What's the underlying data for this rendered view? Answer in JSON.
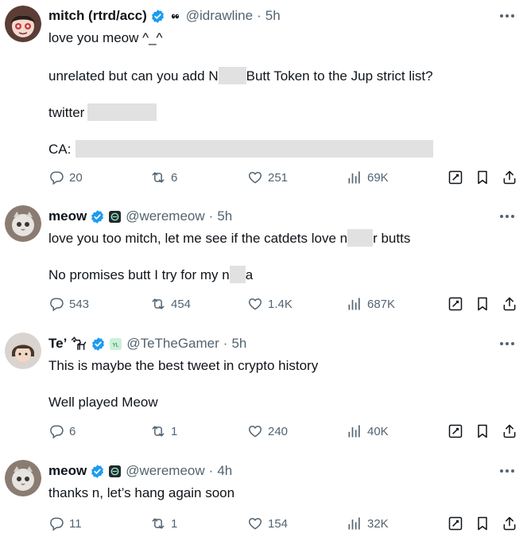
{
  "tweets": [
    {
      "name": "mitch (rtrd/acc)",
      "handle": "@idrawline",
      "time": "5h",
      "text_lines": [
        "love you meow ^_^"
      ],
      "text_parts": {
        "l2_a": "unrelated but can you add N",
        "l2_b": "Butt Token to the Jup strict list?",
        "l3": "twitter",
        "l4": "CA:"
      },
      "stats": {
        "replies": "20",
        "retweets": "6",
        "likes": "251",
        "views": "69K"
      }
    },
    {
      "name": "meow",
      "handle": "@weremeow",
      "time": "5h",
      "text_parts": {
        "l1_a": "love you too mitch, let me see if the catdets love n",
        "l1_b": "r butts",
        "l2_a": "No promises butt I try for my n",
        "l2_b": "a"
      },
      "stats": {
        "replies": "543",
        "retweets": "454",
        "likes": "1.4K",
        "views": "687K"
      }
    },
    {
      "name": "Te’",
      "handle": "@TeTheGamer",
      "time": "5h",
      "text_parts": {
        "l1": "This is maybe the best tweet in crypto history",
        "l2": "Well played Meow"
      },
      "stats": {
        "replies": "6",
        "retweets": "1",
        "likes": "240",
        "views": "40K"
      }
    },
    {
      "name": "meow",
      "handle": "@weremeow",
      "time": "4h",
      "text_parts": {
        "l1": "thanks n, let’s hang again soon"
      },
      "stats": {
        "replies": "11",
        "retweets": "1",
        "likes": "154",
        "views": "32K"
      }
    }
  ],
  "separator": "·",
  "colors": {
    "verified": "#1d9bf0",
    "muted": "#536471",
    "text": "#0f1419",
    "redaction": "#e1e1e1"
  }
}
